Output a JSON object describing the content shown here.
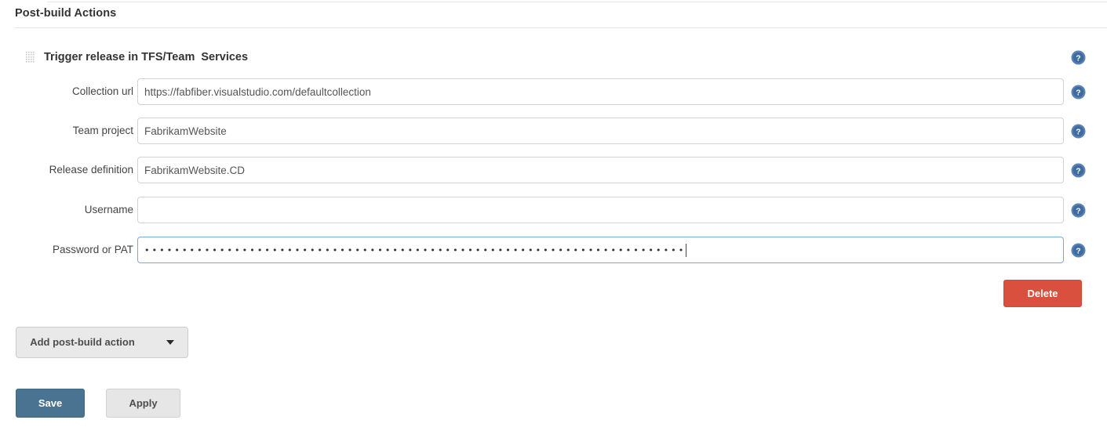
{
  "section": {
    "title": "Post-build Actions"
  },
  "block": {
    "title": "Trigger release in TFS/Team  Services",
    "drag_handle_icon": "drag-grip-icon",
    "help_icon": "help-circle-icon"
  },
  "fields": [
    {
      "label": "Collection url",
      "value": "https://fabfiber.visualstudio.com/defaultcollection",
      "placeholder": "",
      "type": "text",
      "focused": false,
      "name": "collection-url"
    },
    {
      "label": "Team project",
      "value": "FabrikamWebsite",
      "placeholder": "",
      "type": "text",
      "focused": false,
      "name": "team-project"
    },
    {
      "label": "Release definition",
      "value": "FabrikamWebsite.CD",
      "placeholder": "",
      "type": "text",
      "focused": false,
      "name": "release-definition"
    },
    {
      "label": "Username",
      "value": "",
      "placeholder": "",
      "type": "text",
      "focused": false,
      "name": "username"
    },
    {
      "label": "Password or PAT",
      "value": "••••••••••••••••••••••••••••••••••••••••••••••••••••••••••••••••••••••••",
      "placeholder": "",
      "type": "password",
      "focused": true,
      "name": "password-or-pat"
    }
  ],
  "buttons": {
    "delete": "Delete",
    "add_post_build_action": "Add post-build action",
    "save": "Save",
    "apply": "Apply"
  },
  "colors": {
    "delete_red": "#d9503f",
    "save_blue": "#4a7391",
    "help_blue": "#4a76a8",
    "focus_border": "#7ba7de",
    "input_border": "#d2d2d2",
    "text": "#333333"
  }
}
